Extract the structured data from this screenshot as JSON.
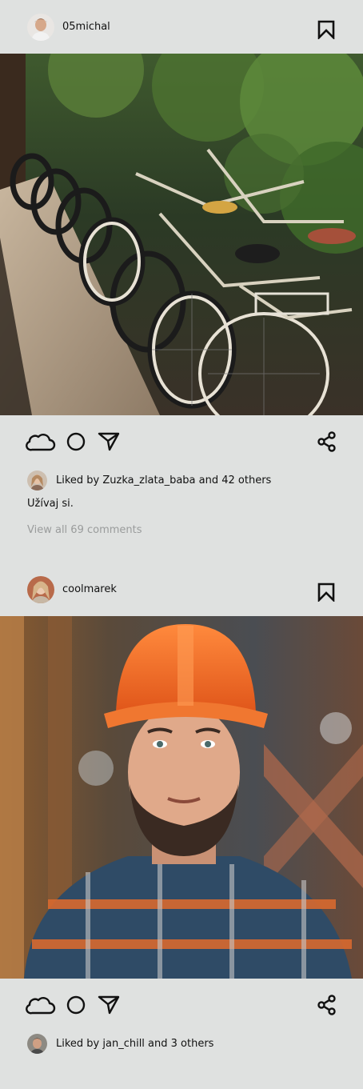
{
  "posts": [
    {
      "username": "05michal",
      "photo_description_icon": "bicycles-photo",
      "likes_text": "Liked by Zuzka_zlata_baba and 42 others",
      "caption": "Užívaj si.",
      "comments_link": "View all 69 comments"
    },
    {
      "username": "coolmarek",
      "photo_description_icon": "construction-worker-photo",
      "likes_text": "Liked by jan_chill and 3 others"
    }
  ],
  "icons": {
    "bookmark": "bookmark-icon",
    "like": "cloud-icon",
    "comment": "circle-icon",
    "send": "send-icon",
    "share": "share-icon"
  },
  "colors": {
    "background": "#dfe1e0",
    "text": "#111111",
    "muted": "#9a9c9c"
  }
}
